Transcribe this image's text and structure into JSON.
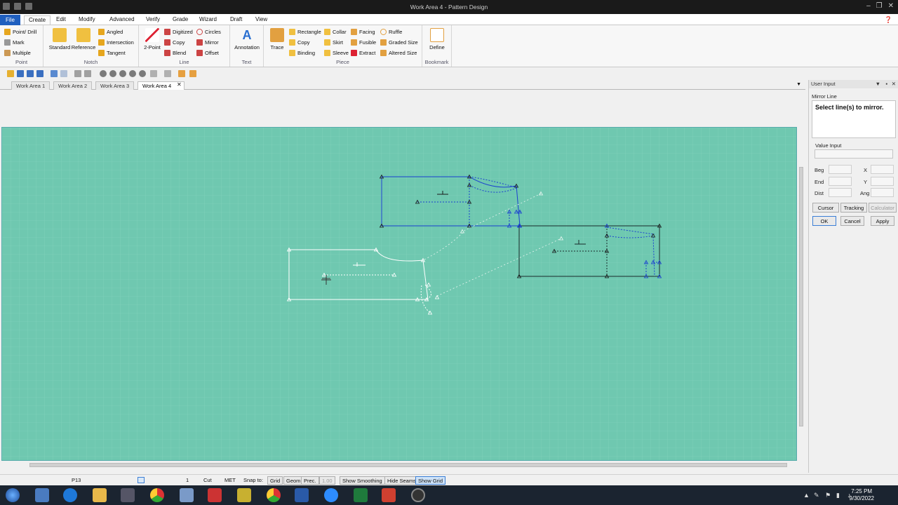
{
  "window": {
    "title": "Work Area 4 - Pattern Design"
  },
  "menu": {
    "tabs": [
      "File",
      "Create",
      "Edit",
      "Modify",
      "Advanced",
      "Verify",
      "Grade",
      "Wizard",
      "Draft",
      "View"
    ],
    "active": "Create"
  },
  "ribbon": {
    "point": {
      "label": "Point",
      "items": [
        "Point/ Drill",
        "Mark",
        "Multiple"
      ]
    },
    "notch": {
      "label": "Notch",
      "big": [
        "Standard",
        "Reference"
      ],
      "items": [
        "Angled",
        "Intersection",
        "Tangent"
      ]
    },
    "line": {
      "label": "Line",
      "big": [
        "2-Point"
      ],
      "items": [
        "Digitized",
        "Copy",
        "Blend",
        "Circles",
        "Mirror",
        "Offset"
      ]
    },
    "text": {
      "label": "Text",
      "big": [
        "Annotation"
      ]
    },
    "piece": {
      "label": "Piece",
      "big": [
        "Trace"
      ],
      "items": [
        "Rectangle",
        "Copy",
        "Binding",
        "Collar",
        "Skirt",
        "Sleeve",
        "Facing",
        "Fusible",
        "Extract",
        "Ruffle",
        "Graded Size",
        "Altered Size"
      ]
    },
    "bookmark": {
      "label": "Bookmark",
      "big": [
        "Define"
      ]
    }
  },
  "doc_tabs": [
    "Work Area 1",
    "Work Area 2",
    "Work Area 3",
    "Work Area 4"
  ],
  "active_doc": "Work Area 4",
  "panel": {
    "title": "User Input",
    "mode": "Mirror Line",
    "prompt": "Select line(s) to mirror.",
    "value_input": "Value Input",
    "rows": [
      {
        "left": "Beg",
        "right": "X"
      },
      {
        "left": "End",
        "right": "Y"
      },
      {
        "left": "Dist",
        "right": "Ang"
      }
    ],
    "mode_buttons": [
      "Cursor",
      "Tracking",
      "Calculator"
    ],
    "action_buttons": [
      "OK",
      "Cancel",
      "Apply"
    ]
  },
  "status": {
    "piece": "P13",
    "count": "1",
    "cut": "Cut",
    "units": "MET",
    "snap_label": "Snap to:",
    "snap_buttons": [
      "Grid",
      "Geom",
      "Prec."
    ],
    "precision": "1.00",
    "toggles": [
      "Show Smoothing",
      "Hide Seams",
      "Show Grid"
    ]
  },
  "clock": {
    "time": "7:25 PM",
    "date": "9/30/2022"
  },
  "colors": {
    "canvas": "#6fc8b0",
    "blue_piece": "#1a3fd0",
    "selected_piece": "#ffffff",
    "dark_piece": "#1a2a2a",
    "file_tab": "#1f5fbf"
  }
}
